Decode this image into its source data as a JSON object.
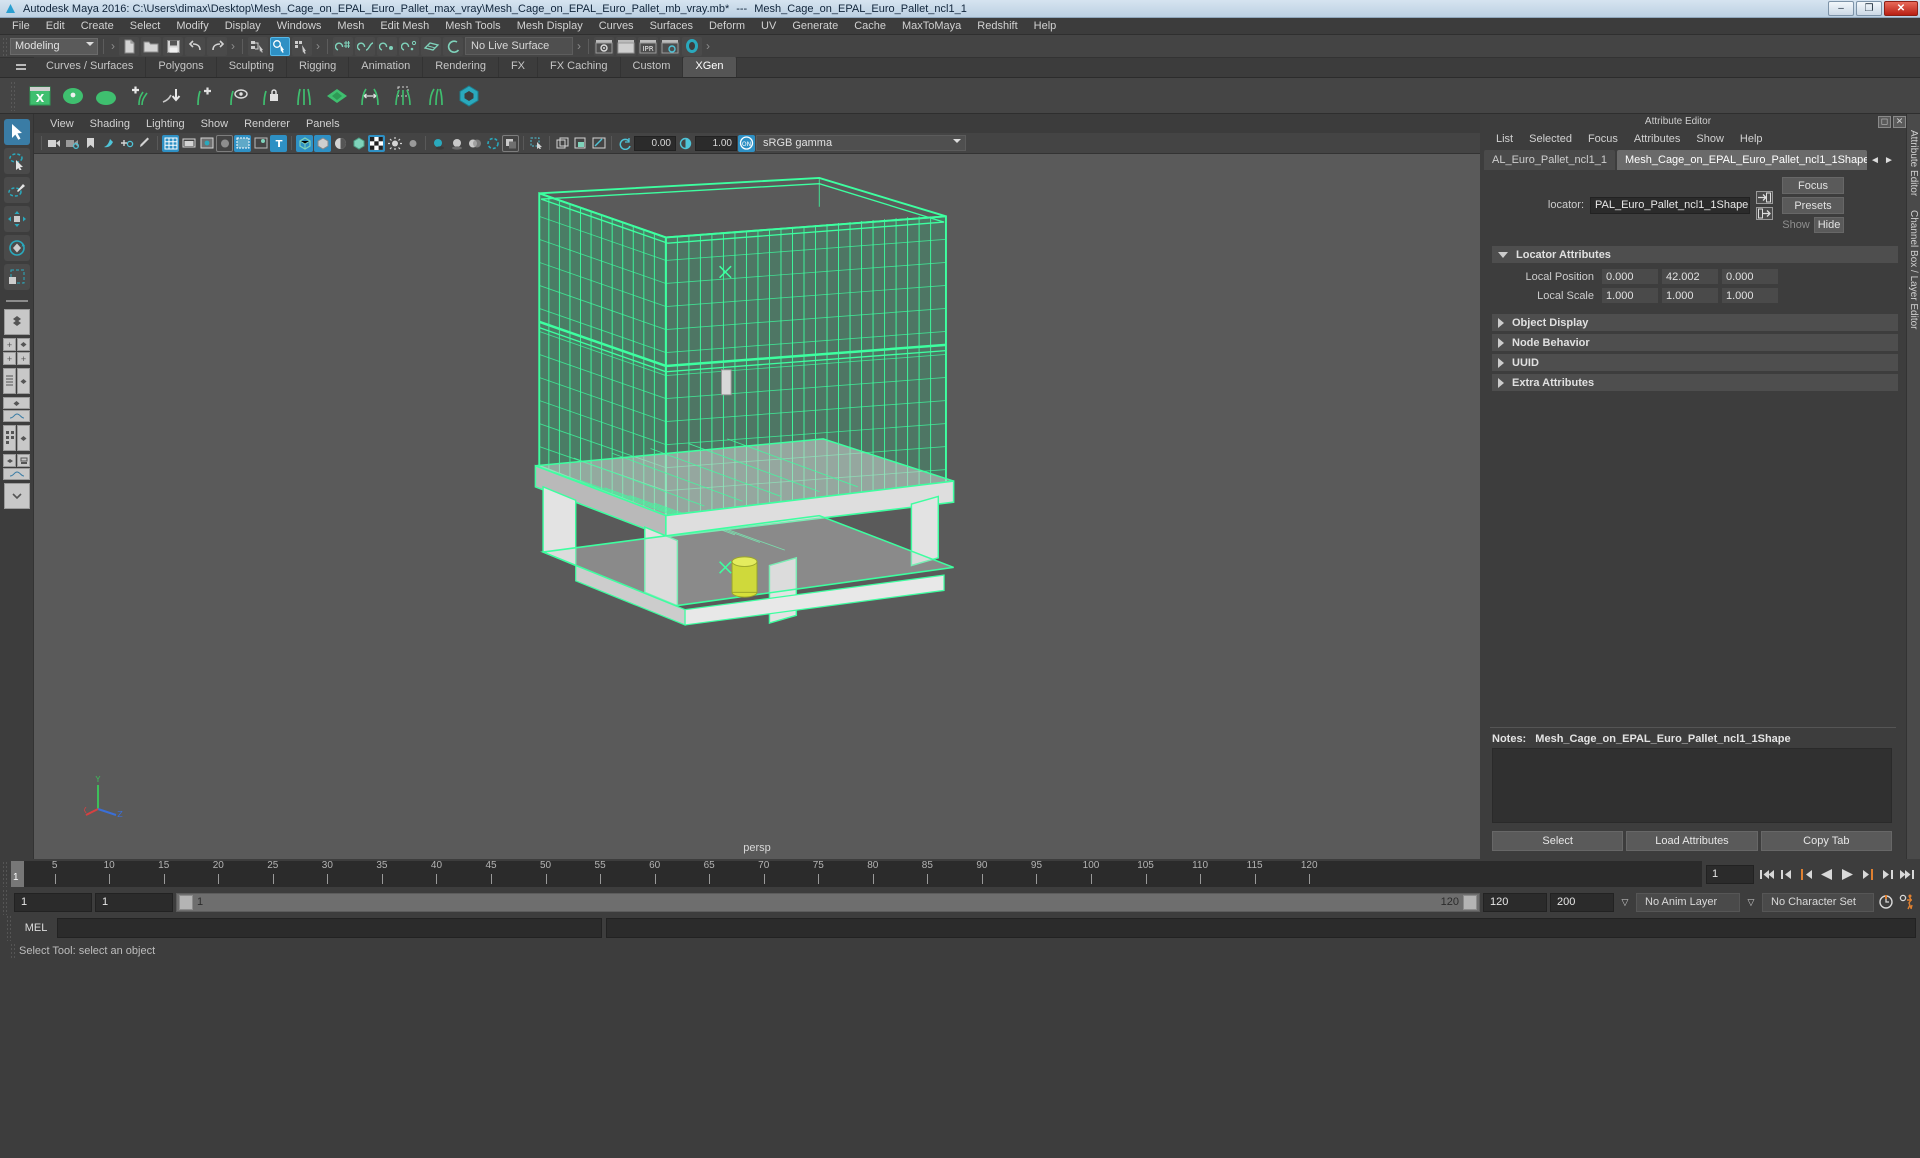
{
  "window": {
    "app_title": "Autodesk Maya 2016: C:\\Users\\dimax\\Desktop\\Mesh_Cage_on_EPAL_Euro_Pallet_max_vray\\Mesh_Cage_on_EPAL_Euro_Pallet_mb_vray.mb*",
    "separator": "---",
    "object_title": "Mesh_Cage_on_EPAL_Euro_Pallet_ncl1_1",
    "minimize": "–",
    "maximize": "❐",
    "close": "✕"
  },
  "menubar": [
    "File",
    "Edit",
    "Create",
    "Select",
    "Modify",
    "Display",
    "Windows",
    "Mesh",
    "Edit Mesh",
    "Mesh Tools",
    "Mesh Display",
    "Curves",
    "Surfaces",
    "Deform",
    "UV",
    "Generate",
    "Cache",
    "MaxToMaya",
    "Redshift",
    "Help"
  ],
  "statusline": {
    "menuset": "Modeling",
    "live_surface": "No Live Surface"
  },
  "shelf": {
    "tabs": [
      "Curves / Surfaces",
      "Polygons",
      "Sculpting",
      "Rigging",
      "Animation",
      "Rendering",
      "FX",
      "FX Caching",
      "Custom",
      "XGen"
    ],
    "active_tab": "XGen"
  },
  "viewport": {
    "menus": [
      "View",
      "Shading",
      "Lighting",
      "Show",
      "Renderer",
      "Panels"
    ],
    "exposure": "0.00",
    "gamma_value": "1.00",
    "color_management": "sRGB gamma",
    "camera_label": "persp",
    "axis": {
      "y": "Y",
      "x": "X",
      "z": "Z"
    }
  },
  "attribute_editor": {
    "panel_title": "Attribute Editor",
    "menus": [
      "List",
      "Selected",
      "Focus",
      "Attributes",
      "Show",
      "Help"
    ],
    "tabs": [
      {
        "label": "AL_Euro_Pallet_ncl1_1",
        "active": false
      },
      {
        "label": "Mesh_Cage_on_EPAL_Euro_Pallet_ncl1_1Shape",
        "active": true
      }
    ],
    "nav_prev": "◄",
    "nav_next": "►",
    "node_label": "locator:",
    "node_name": "PAL_Euro_Pallet_ncl1_1Shape",
    "focus_button": "Focus",
    "presets_button": "Presets",
    "show_button": "Show",
    "hide_button": "Hide",
    "sections": [
      {
        "title": "Locator Attributes",
        "open": true
      },
      {
        "title": "Object Display",
        "open": false
      },
      {
        "title": "Node Behavior",
        "open": false
      },
      {
        "title": "UUID",
        "open": false
      },
      {
        "title": "Extra Attributes",
        "open": false
      }
    ],
    "attributes": [
      {
        "label": "Local Position",
        "values": [
          "0.000",
          "42.002",
          "0.000"
        ]
      },
      {
        "label": "Local Scale",
        "values": [
          "1.000",
          "1.000",
          "1.000"
        ]
      }
    ],
    "notes_label": "Notes:",
    "notes_node": "Mesh_Cage_on_EPAL_Euro_Pallet_ncl1_1Shape",
    "notes_text": "",
    "footer_buttons": [
      "Select",
      "Load Attributes",
      "Copy Tab"
    ],
    "side_tabs": [
      "Attribute Editor",
      "Channel Box / Layer Editor"
    ]
  },
  "timeline": {
    "ticks": [
      5,
      10,
      15,
      20,
      25,
      30,
      35,
      40,
      45,
      50,
      55,
      60,
      65,
      70,
      75,
      80,
      85,
      90,
      95,
      100,
      105,
      110,
      115,
      120
    ],
    "current_frame": "1",
    "current_frame_field": "1",
    "range_start": "1",
    "range_end": "1",
    "slider_start_value": "1",
    "slider_end_value": "120",
    "anim_start": "120",
    "anim_end": "200",
    "anim_layer": "No Anim Layer",
    "character_set": "No Character Set"
  },
  "command_line": {
    "language": "MEL",
    "input_value": "",
    "result_value": ""
  },
  "status": {
    "help_text": "Select Tool: select an object"
  },
  "colors": {
    "accent_blue": "#2e90c4",
    "wireframe_green": "#3dffa0",
    "viewport_bg": "#5a5a5a",
    "panel_bg": "#3d3d3d",
    "orange": "#e08030"
  }
}
